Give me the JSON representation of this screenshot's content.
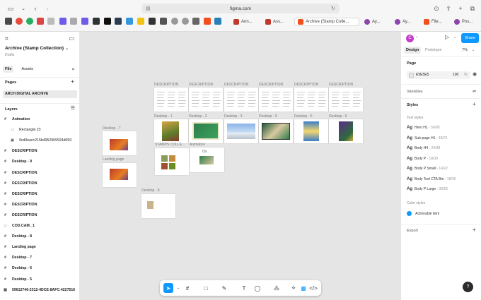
{
  "browser": {
    "url": "figma.com",
    "tabs": [
      {
        "label": "Ann...",
        "color": "#c0392b"
      },
      {
        "label": "Ass...",
        "color": "#c0392b"
      },
      {
        "label": "Archive (Stamp Colle...",
        "color": "#f24e1e",
        "active": true
      },
      {
        "label": "Ay...",
        "color": "#8e44ad"
      },
      {
        "label": "Ay...",
        "color": "#8e44ad"
      },
      {
        "label": "File...",
        "color": "#f24e1e"
      },
      {
        "label": "Pos...",
        "color": "#8e44ad"
      }
    ]
  },
  "left_panel": {
    "file_title": "Archive (Stamp Collection)",
    "file_subtitle": "Drafts",
    "tab_file": "File",
    "tab_assets": "Assets",
    "pages_heading": "Pages",
    "current_page": "ARCH DIGITAL ARCHIVE",
    "layers_heading": "Layers",
    "layers": [
      {
        "label": "Animation",
        "icon": "#",
        "sub": false
      },
      {
        "label": "Rectangle 23",
        "icon": "□",
        "sub": true
      },
      {
        "label": "9cd3eacc215b4952909924d093",
        "icon": "▣",
        "sub": true
      },
      {
        "label": "DESCRIPTION",
        "icon": "#",
        "sub": false
      },
      {
        "label": "Desktop - 9",
        "icon": "#",
        "sub": false
      },
      {
        "label": "DESCRIPTION",
        "icon": "#",
        "sub": false
      },
      {
        "label": "DESCRIPTION",
        "icon": "#",
        "sub": false
      },
      {
        "label": "DESCRIPTION",
        "icon": "#",
        "sub": false
      },
      {
        "label": "DESCRIPTION",
        "icon": "#",
        "sub": false
      },
      {
        "label": "DESCRIPTION",
        "icon": "#",
        "sub": false
      },
      {
        "label": "COD.CAM._1",
        "icon": "□",
        "sub": false
      },
      {
        "label": "Desktop - 8",
        "icon": "#",
        "sub": false
      },
      {
        "label": "Landing page",
        "icon": "#",
        "sub": false
      },
      {
        "label": "Desktop - 7",
        "icon": "#",
        "sub": false
      },
      {
        "label": "Desktop - 6",
        "icon": "#",
        "sub": false
      },
      {
        "label": "Desktop - 5",
        "icon": "#",
        "sub": false
      },
      {
        "label": "59612746-2312-4DCE-8AFC-4227516",
        "icon": "▣",
        "sub": false
      }
    ]
  },
  "canvas": {
    "labels": {
      "desc1": "DESCRIPTION",
      "desc2": "DESCRIPTION",
      "desc3": "DESCRIPTION",
      "desc4": "DESCRIPTION",
      "desc5": "DESCRIPTION",
      "desc6": "DESCRIPTION",
      "d1": "Desktop - 1",
      "d2": "Desktop - 2",
      "d3": "Desktop - 3",
      "d9": "Desktop - 9",
      "d5": "Desktop - 5",
      "d6": "Desktop - 6",
      "d7": "Desktop - 7",
      "landing": "Landing page",
      "stamps": "STAMPS COLLE...",
      "animation": "Animation",
      "d8": "Desktop - 8"
    },
    "animation_frame_text": "Ox"
  },
  "toolbar": {
    "tools": [
      "move-tool",
      "frame-tool",
      "shape-tool",
      "pen-tool",
      "text-tool",
      "comment-tool",
      "actions-tool",
      "dev-mode-toggle",
      "prototype-toggle",
      "code-toggle"
    ]
  },
  "right_panel": {
    "avatar_letter": "C",
    "share_label": "Share",
    "tab_design": "Design",
    "tab_prototype": "Prototype",
    "zoom": "7%",
    "page_heading": "Page",
    "page_color_hex": "E5E5E5",
    "page_color_opacity": "100",
    "page_color_unit": "%",
    "variables_heading": "Variables",
    "styles_heading": "Styles",
    "text_styles_heading": "Text styles",
    "text_styles": [
      {
        "ag": "Ag",
        "name": "Hero H1",
        "spec": "56/90"
      },
      {
        "ag": "Ag",
        "name": "Sub-page H1",
        "spec": "48/72"
      },
      {
        "ag": "Ag",
        "name": "Body H4",
        "spec": "24/38"
      },
      {
        "ag": "Ag",
        "name": "Body P",
        "spec": "18/30"
      },
      {
        "ag": "Ag",
        "name": "Body P Small",
        "spec": "14/22"
      },
      {
        "ag": "Ag",
        "name": "Body Text CTA Btn",
        "spec": "18/30"
      },
      {
        "ag": "Ag",
        "name": "Body P Large",
        "spec": "36/52"
      }
    ],
    "color_styles_heading": "Color styles",
    "color_styles": [
      {
        "name": "Actionable item",
        "color": "#0d99ff"
      }
    ],
    "export_heading": "Export"
  },
  "help_label": "?"
}
